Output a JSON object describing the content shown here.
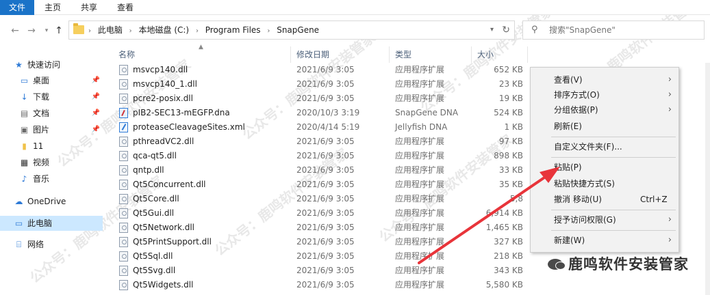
{
  "ribbon": {
    "tabs": [
      "文件",
      "主页",
      "共享",
      "查看"
    ]
  },
  "address": {
    "crumbs": [
      "此电脑",
      "本地磁盘 (C:)",
      "Program Files",
      "SnapGene"
    ]
  },
  "search": {
    "placeholder": "搜索\"SnapGene\""
  },
  "nav": {
    "items": [
      {
        "label": "快速访问",
        "icon": "star-icon"
      },
      {
        "label": "桌面",
        "icon": "desktop-icon"
      },
      {
        "label": "下载",
        "icon": "download-icon"
      },
      {
        "label": "文档",
        "icon": "document-icon"
      },
      {
        "label": "图片",
        "icon": "picture-icon"
      },
      {
        "label": "11",
        "icon": "folder-icon"
      },
      {
        "label": "视频",
        "icon": "video-icon"
      },
      {
        "label": "音乐",
        "icon": "music-icon"
      },
      {
        "label": "OneDrive",
        "icon": "cloud-icon"
      },
      {
        "label": "此电脑",
        "icon": "computer-icon"
      },
      {
        "label": "网络",
        "icon": "network-icon"
      }
    ]
  },
  "columns": {
    "name": "名称",
    "date": "修改日期",
    "type": "类型",
    "size": "大小"
  },
  "files": [
    {
      "name": "msvcp140.dll",
      "date": "2021/6/9 3:05",
      "type": "应用程序扩展",
      "size": "652 KB"
    },
    {
      "name": "msvcp140_1.dll",
      "date": "2021/6/9 3:05",
      "type": "应用程序扩展",
      "size": "23 KB"
    },
    {
      "name": "pcre2-posix.dll",
      "date": "2021/6/9 3:05",
      "type": "应用程序扩展",
      "size": "19 KB"
    },
    {
      "name": "pIB2-SEC13-mEGFP.dna",
      "date": "2020/10/3 3:19",
      "type": "SnapGene DNA",
      "size": "524 KB"
    },
    {
      "name": "proteaseCleavageSites.xml",
      "date": "2020/4/14 5:19",
      "type": "Jellyfish DNA",
      "size": "1 KB"
    },
    {
      "name": "pthreadVC2.dll",
      "date": "2021/6/9 3:05",
      "type": "应用程序扩展",
      "size": "97 KB"
    },
    {
      "name": "qca-qt5.dll",
      "date": "2021/6/9 3:05",
      "type": "应用程序扩展",
      "size": "898 KB"
    },
    {
      "name": "qntp.dll",
      "date": "2021/6/9 3:05",
      "type": "应用程序扩展",
      "size": "33 KB"
    },
    {
      "name": "Qt5Concurrent.dll",
      "date": "2021/6/9 3:05",
      "type": "应用程序扩展",
      "size": "35 KB"
    },
    {
      "name": "Qt5Core.dll",
      "date": "2021/6/9 3:05",
      "type": "应用程序扩展",
      "size": "5,8"
    },
    {
      "name": "Qt5Gui.dll",
      "date": "2021/6/9 3:05",
      "type": "应用程序扩展",
      "size": "6,914 KB"
    },
    {
      "name": "Qt5Network.dll",
      "date": "2021/6/9 3:05",
      "type": "应用程序扩展",
      "size": "1,465 KB"
    },
    {
      "name": "Qt5PrintSupport.dll",
      "date": "2021/6/9 3:05",
      "type": "应用程序扩展",
      "size": "327 KB"
    },
    {
      "name": "Qt5Sql.dll",
      "date": "2021/6/9 3:05",
      "type": "应用程序扩展",
      "size": "218 KB"
    },
    {
      "name": "Qt5Svg.dll",
      "date": "2021/6/9 3:05",
      "type": "应用程序扩展",
      "size": "343 KB"
    },
    {
      "name": "Qt5Widgets.dll",
      "date": "2021/6/9 3:05",
      "type": "应用程序扩展",
      "size": "5,580 KB"
    }
  ],
  "context_menu": {
    "items": [
      {
        "label": "查看(V)",
        "submenu": true
      },
      {
        "label": "排序方式(O)",
        "submenu": true
      },
      {
        "label": "分组依据(P)",
        "submenu": true
      },
      {
        "label": "刷新(E)"
      },
      {
        "label": "自定义文件夹(F)..."
      },
      {
        "label": "粘贴(P)"
      },
      {
        "label": "粘贴快捷方式(S)"
      },
      {
        "label": "撤消 移动(U)",
        "shortcut": "Ctrl+Z"
      },
      {
        "label": "授予访问权限(G)",
        "submenu": true
      },
      {
        "label": "新建(W)",
        "submenu": true
      }
    ]
  },
  "watermark": "公众号：鹿鸣软件安装管家",
  "brand": "鹿鸣软件安装管家",
  "colors": {
    "accent": "#1a73c8",
    "selection": "#cce8ff",
    "arrow": "#e8343a"
  }
}
